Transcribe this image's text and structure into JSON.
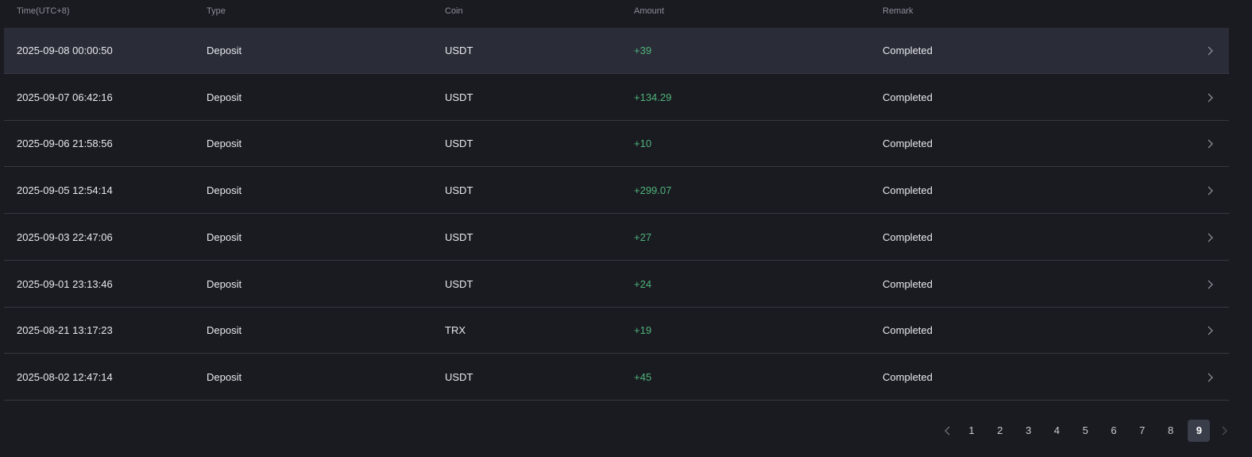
{
  "table": {
    "headers": {
      "time": "Time(UTC+8)",
      "type": "Type",
      "coin": "Coin",
      "amount": "Amount",
      "remark": "Remark"
    },
    "rows": [
      {
        "time": "2025-09-08 00:00:50",
        "type": "Deposit",
        "coin": "USDT",
        "amount": "+39",
        "remark": "Completed"
      },
      {
        "time": "2025-09-07 06:42:16",
        "type": "Deposit",
        "coin": "USDT",
        "amount": "+134.29",
        "remark": "Completed"
      },
      {
        "time": "2025-09-06 21:58:56",
        "type": "Deposit",
        "coin": "USDT",
        "amount": "+10",
        "remark": "Completed"
      },
      {
        "time": "2025-09-05 12:54:14",
        "type": "Deposit",
        "coin": "USDT",
        "amount": "+299.07",
        "remark": "Completed"
      },
      {
        "time": "2025-09-03 22:47:06",
        "type": "Deposit",
        "coin": "USDT",
        "amount": "+27",
        "remark": "Completed"
      },
      {
        "time": "2025-09-01 23:13:46",
        "type": "Deposit",
        "coin": "USDT",
        "amount": "+24",
        "remark": "Completed"
      },
      {
        "time": "2025-08-21 13:17:23",
        "type": "Deposit",
        "coin": "TRX",
        "amount": "+19",
        "remark": "Completed"
      },
      {
        "time": "2025-08-02 12:47:14",
        "type": "Deposit",
        "coin": "USDT",
        "amount": "+45",
        "remark": "Completed"
      }
    ]
  },
  "pagination": {
    "pages": [
      "1",
      "2",
      "3",
      "4",
      "5",
      "6",
      "7",
      "8",
      "9"
    ],
    "current": "9",
    "prev_icon": "chevron-left-icon",
    "next_icon": "chevron-right-icon"
  },
  "colors": {
    "background": "#1a1b21",
    "row_highlight": "#2a2d38",
    "divider": "#363843",
    "amount_positive": "#4fb37a",
    "text_primary": "#e8e9ed",
    "text_header": "#8d8f99",
    "page_active_bg": "#3a3d4a"
  }
}
